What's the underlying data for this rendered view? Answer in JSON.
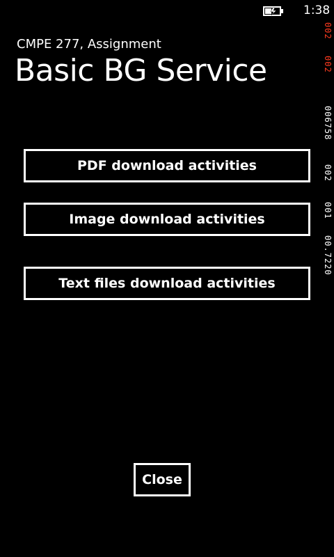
{
  "status_bar": {
    "time": "1:38",
    "battery_icon": "battery-charging-icon"
  },
  "header": {
    "app_title": "CMPE 277, Assignment",
    "page_title": "Basic BG Service"
  },
  "buttons": {
    "pdf": "PDF download activities",
    "image": "Image download activities",
    "text": "Text files download activities",
    "close": "Close"
  },
  "frame_counters": {
    "values": [
      "002",
      "002",
      "006758",
      "002",
      "001",
      "00.7220"
    ],
    "colors": [
      "#ff3b1f",
      "#ff3b1f",
      "#ffffff",
      "#ffffff",
      "#ffffff",
      "#ffffff"
    ]
  },
  "colors": {
    "background": "#000000",
    "foreground": "#ffffff",
    "counter_alert": "#ff3b1f"
  }
}
